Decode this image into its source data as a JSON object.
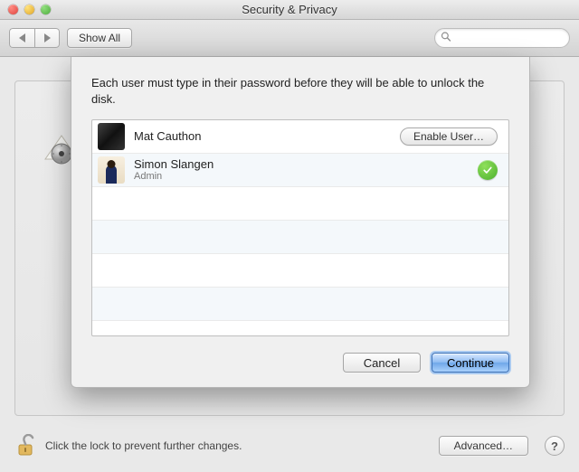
{
  "window": {
    "title": "Security & Privacy"
  },
  "toolbar": {
    "show_all": "Show All",
    "search_placeholder": ""
  },
  "sheet": {
    "message": "Each user must type in their password before they will be able to unlock the disk.",
    "users": [
      {
        "name": "Mat Cauthon",
        "subtitle": "",
        "enabled": false,
        "enable_label": "Enable User…"
      },
      {
        "name": "Simon Slangen",
        "subtitle": "Admin",
        "enabled": true,
        "enable_label": ""
      }
    ],
    "cancel": "Cancel",
    "continue": "Continue"
  },
  "footer": {
    "lock_text": "Click the lock to prevent further changes.",
    "advanced": "Advanced…",
    "help": "?"
  }
}
